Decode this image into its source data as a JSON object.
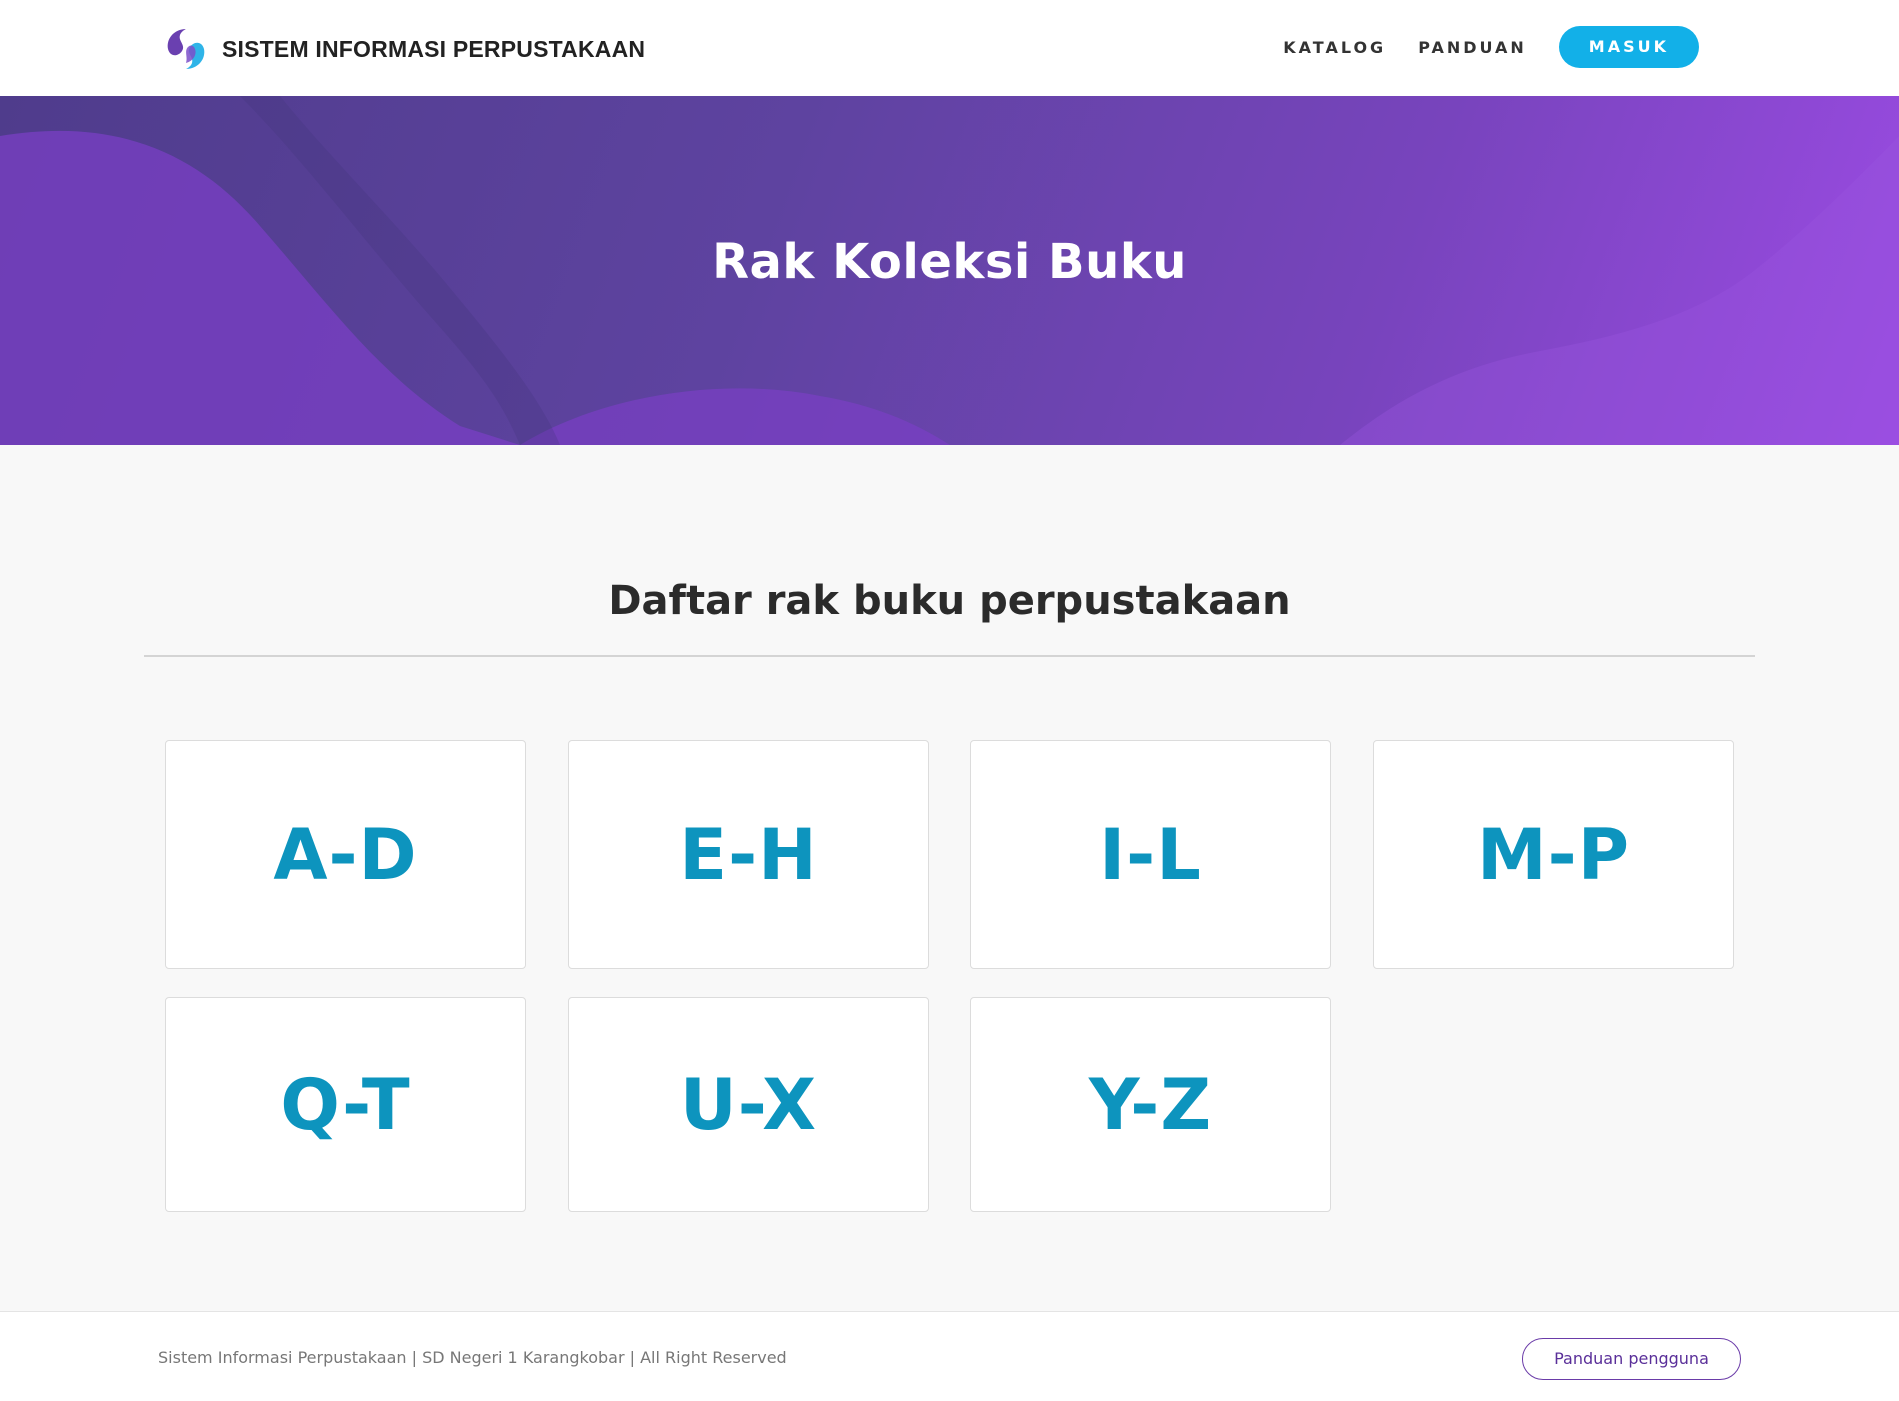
{
  "header": {
    "brand_name": "SISTEM INFORMASI PERPUSTAKAAN",
    "brand_colors": {
      "left": "#6a40b0",
      "right": "#2fb4e8"
    },
    "nav": {
      "katalog": "KATALOG",
      "panduan": "PANDUAN",
      "masuk": "MASUK"
    },
    "accent_color": "#12b0e8"
  },
  "hero": {
    "title": "Rak Koleksi Buku",
    "gradient": [
      "#4f3c8c",
      "#9b4be3"
    ]
  },
  "main": {
    "section_title": "Daftar rak buku perpustakaan",
    "shelves": [
      "A-D",
      "E-H",
      "I-L",
      "M-P",
      "Q-T",
      "U-X",
      "Y-Z"
    ],
    "shelf_label_color": "#0d94be"
  },
  "footer": {
    "copyright": "Sistem Informasi Perpustakaan | SD Negeri 1 Karangkobar | All Right Reserved",
    "guide_button": "Panduan pengguna"
  }
}
